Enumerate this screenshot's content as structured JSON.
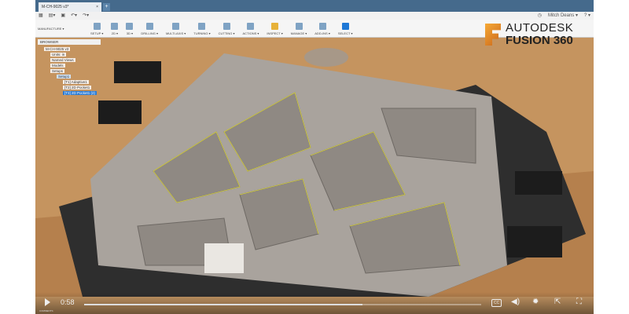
{
  "window": {
    "doc_tab": "M-CH-9025 v3*",
    "new_tab": "+",
    "user": "Mitch Deans ▾",
    "help": "? ▾"
  },
  "ribbon": {
    "workspace": "MANUFACTURE ▾",
    "groups": [
      "SETUP ▾",
      "2D ▾",
      "3D ▾",
      "DRILLING ▾",
      "MULTI-AXIS ▾",
      "TURNING ▾",
      "CUTTING ▾",
      "ACTIONS ▾",
      "INSPECT ▾",
      "MANAGE ▾",
      "ADD-INS ▾",
      "SELECT ▾"
    ]
  },
  "browser": {
    "title": "BROWSER",
    "items": [
      {
        "label": "M-CH-9025 v3",
        "level": 0
      },
      {
        "label": "Units: in",
        "level": 1
      },
      {
        "label": "Named Views",
        "level": 1
      },
      {
        "label": "Models",
        "level": 1
      },
      {
        "label": "Setups",
        "level": 1
      },
      {
        "label": "Setup1",
        "level": 2
      },
      {
        "label": "[T1] Adaptive1",
        "level": 3
      },
      {
        "label": "[T2] 2D Pocket1",
        "level": 3
      },
      {
        "label": "[T3] 2D Pocket1 (2)",
        "level": 3
      }
    ]
  },
  "logo": {
    "line1": "AUTODESK",
    "line2": "FUSION 360"
  },
  "video": {
    "time": "0:58",
    "progress": 0.7,
    "comments_label": "COMMENTS",
    "cc": "CC"
  },
  "colors": {
    "titlebar": "#456a8c",
    "select": "#1e78d6",
    "plate": "#a9a39d",
    "wood": "#c99a66",
    "toolpath": "#d8d23a"
  }
}
